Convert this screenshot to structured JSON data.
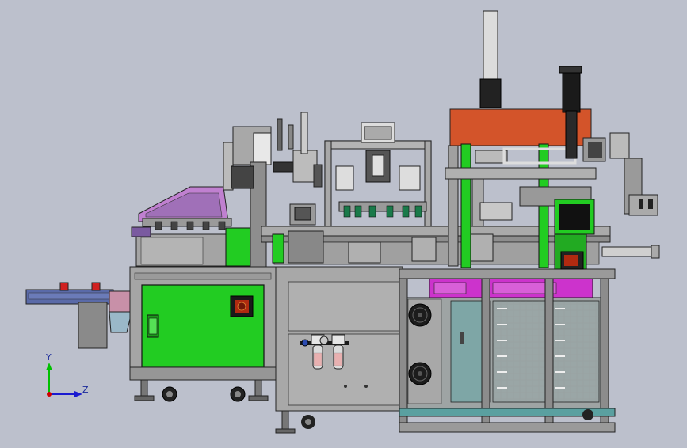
{
  "viewport": {
    "background": "#bcc0cc",
    "palette": {
      "frame": "#9a9a9a",
      "panel": "#a8a8a8",
      "green": "#22cc22",
      "red_orange": "#d3542a",
      "magenta": "#cc33cc",
      "purple": "#7a5aa0",
      "blue": "#4a6aa0",
      "teal": "#5fa6a6",
      "dark": "#2a2a2a"
    }
  },
  "triad": {
    "y_label": "Y",
    "z_label": "Z",
    "y_color": "#00c000",
    "z_color": "#1a1ad0",
    "x_color": "#d00000"
  }
}
